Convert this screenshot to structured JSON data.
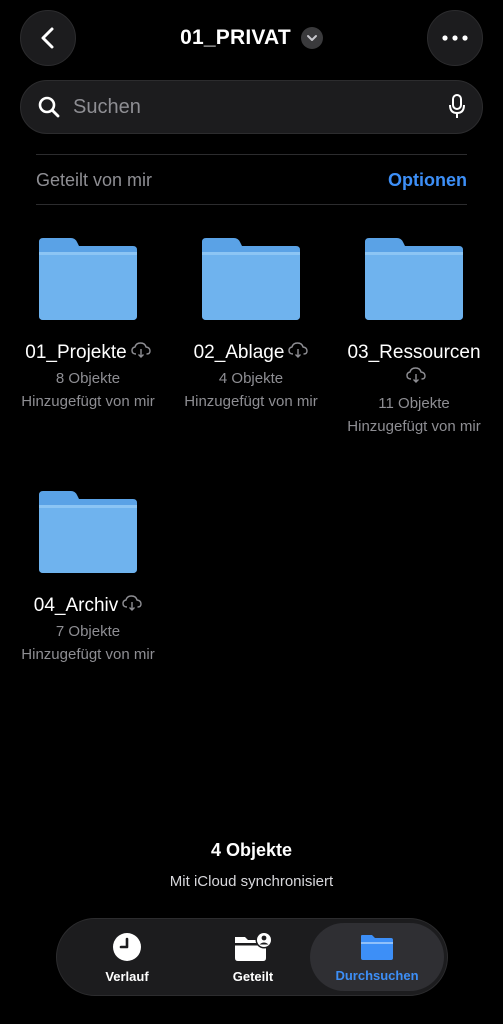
{
  "header": {
    "title": "01_PRIVAT",
    "back_icon": "chevron-left-icon",
    "more_icon": "ellipsis-icon"
  },
  "search": {
    "placeholder": "Suchen",
    "value": ""
  },
  "section": {
    "title": "Geteilt von mir",
    "options_label": "Optionen"
  },
  "folders": [
    {
      "name": "01_Projekte",
      "count": "8 Objekte",
      "added": "Hinzugefügt von mir"
    },
    {
      "name": "02_Ablage",
      "count": "4 Objekte",
      "added": "Hinzugefügt von mir"
    },
    {
      "name": "03_Ressourcen",
      "count": "11 Objekte",
      "added": "Hinzugefügt von mir"
    },
    {
      "name": "04_Archiv",
      "count": "7 Objekte",
      "added": "Hinzugefügt von mir"
    }
  ],
  "footer": {
    "count": "4 Objekte",
    "sync": "Mit iCloud synchronisiert"
  },
  "tabs": [
    {
      "label": "Verlauf",
      "icon": "clock-icon",
      "active": false
    },
    {
      "label": "Geteilt",
      "icon": "shared-folder-icon",
      "active": false
    },
    {
      "label": "Durchsuchen",
      "icon": "folder-icon",
      "active": true
    }
  ],
  "colors": {
    "accent": "#3d8ff7",
    "folder": "#6fb3ee",
    "background": "#000000"
  }
}
